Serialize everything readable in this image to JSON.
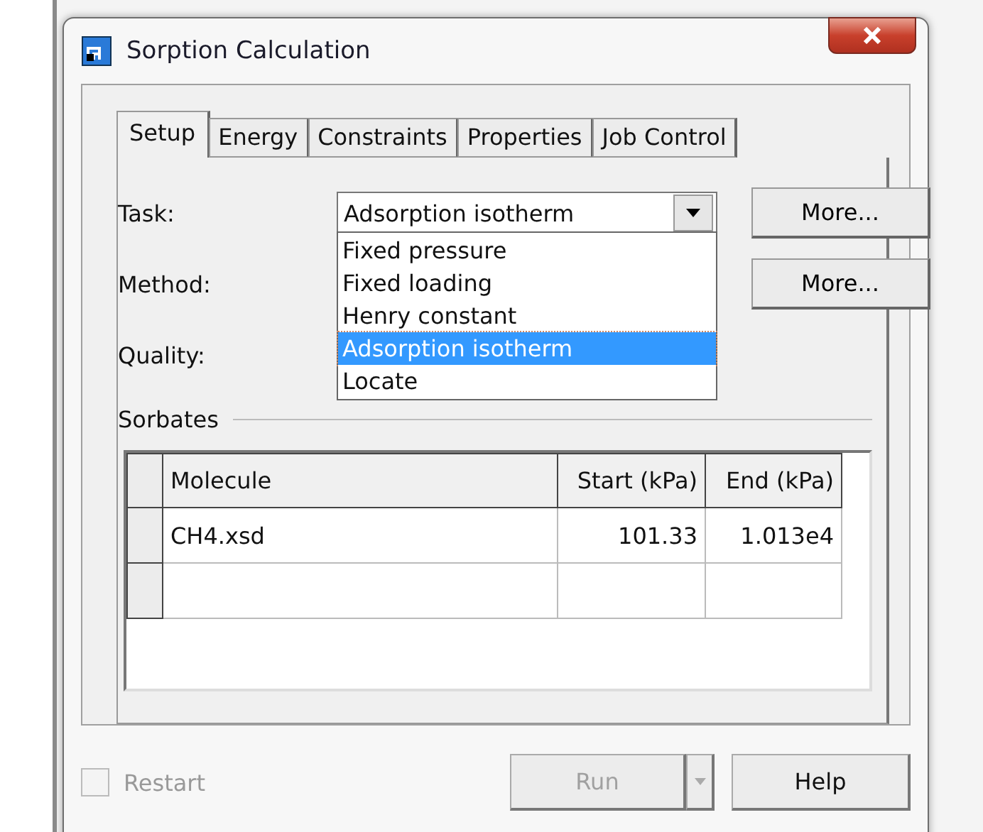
{
  "window": {
    "title": "Sorption Calculation"
  },
  "tabs": [
    {
      "label": "Setup",
      "selected": true
    },
    {
      "label": "Energy",
      "selected": false
    },
    {
      "label": "Constraints",
      "selected": false
    },
    {
      "label": "Properties",
      "selected": false
    },
    {
      "label": "Job Control",
      "selected": false
    }
  ],
  "form": {
    "task_label": "Task:",
    "task_value": "Adsorption isotherm",
    "task_more": "More...",
    "method_label": "Method:",
    "method_more": "More...",
    "quality_label": "Quality:",
    "task_options": [
      {
        "label": "Fixed pressure",
        "selected": false
      },
      {
        "label": "Fixed loading",
        "selected": false
      },
      {
        "label": "Henry constant",
        "selected": false
      },
      {
        "label": "Adsorption isotherm",
        "selected": true
      },
      {
        "label": "Locate",
        "selected": false
      }
    ]
  },
  "sorbates": {
    "title": "Sorbates",
    "columns": [
      "Molecule",
      "Start (kPa)",
      "End (kPa)"
    ],
    "rows": [
      [
        "CH4.xsd",
        "101.33",
        "1.013e4"
      ],
      [
        "",
        "",
        ""
      ]
    ]
  },
  "footer": {
    "restart": {
      "label": "Restart",
      "checked": false,
      "disabled": true
    },
    "run": {
      "label": "Run",
      "disabled": true
    },
    "help": {
      "label": "Help",
      "disabled": false
    }
  }
}
